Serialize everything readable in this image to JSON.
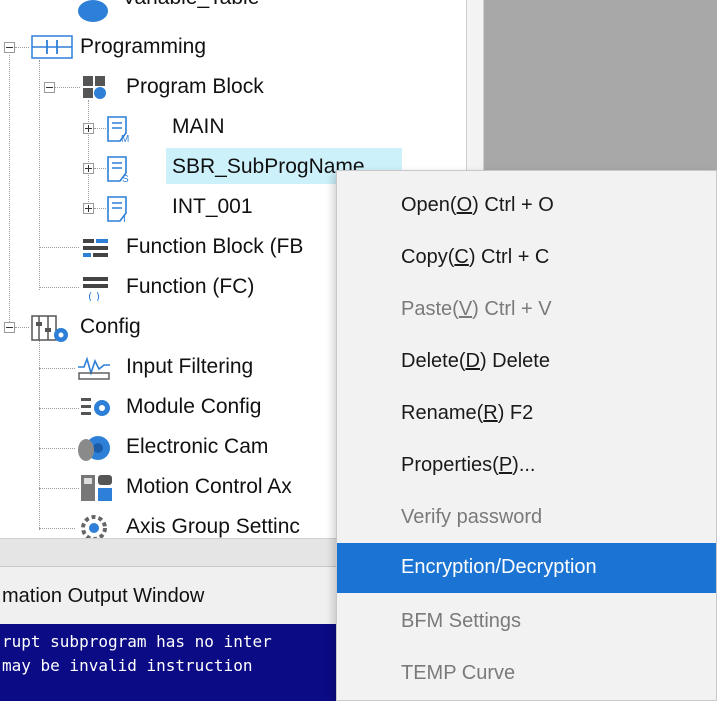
{
  "tree": {
    "items": [
      {
        "label": "Variable_Table",
        "icon": "variable-table-icon"
      },
      {
        "label": "Programming",
        "icon": "ladder-icon",
        "expander": "minus"
      },
      {
        "label": "Program Block",
        "icon": "program-block-icon",
        "expander": "minus"
      },
      {
        "label": "MAIN",
        "icon": "main-program-icon",
        "expander": "plus"
      },
      {
        "label": "SBR_SubProgName",
        "icon": "subroutine-icon",
        "expander": "plus",
        "selected": true
      },
      {
        "label": "INT_001",
        "icon": "interrupt-icon",
        "expander": "plus"
      },
      {
        "label": "Function Block (FB",
        "icon": "function-block-icon"
      },
      {
        "label": "Function (FC)",
        "icon": "function-icon"
      },
      {
        "label": "Config",
        "icon": "config-icon",
        "expander": "minus"
      },
      {
        "label": "Input Filtering",
        "icon": "input-filtering-icon"
      },
      {
        "label": "Module Config",
        "icon": "module-config-icon"
      },
      {
        "label": "Electronic Cam",
        "icon": "electronic-cam-icon"
      },
      {
        "label": "Motion Control Ax",
        "icon": "motion-control-icon"
      },
      {
        "label": "Axis Group Settinc",
        "icon": "axis-group-icon"
      }
    ]
  },
  "output": {
    "title": "mation Output Window",
    "lines": [
      "rupt subprogram has no inter",
      " may be invalid instruction"
    ]
  },
  "menu": {
    "items": [
      {
        "label": "Open(O) Ctrl + O",
        "pre": "Open(",
        "key": "O",
        "post": ") Ctrl + O",
        "enabled": true
      },
      {
        "label": "Copy(C) Ctrl + C",
        "pre": "Copy(",
        "key": "C",
        "post": ") Ctrl + C",
        "enabled": true
      },
      {
        "label": "Paste(V) Ctrl + V",
        "pre": "Paste(",
        "key": "V",
        "post": ") Ctrl + V",
        "enabled": false
      },
      {
        "label": "Delete(D) Delete",
        "pre": "Delete(",
        "key": "D",
        "post": ") Delete",
        "enabled": true
      },
      {
        "label": "Rename(R) F2",
        "pre": "Rename(",
        "key": "R",
        "post": ") F2",
        "enabled": true
      },
      {
        "label": "Properties(P)...",
        "pre": "Properties(",
        "key": "P",
        "post": ")...",
        "enabled": true
      },
      {
        "label": "Verify password",
        "pre": "Verify password",
        "key": "",
        "post": "",
        "enabled": false
      },
      {
        "label": "Encryption/Decryption",
        "pre": "Encryption/Decryption",
        "key": "",
        "post": "",
        "enabled": true,
        "highlighted": true
      },
      {
        "label": "BFM Settings",
        "pre": "BFM Settings",
        "key": "",
        "post": "",
        "enabled": false
      },
      {
        "label": "TEMP Curve",
        "pre": "TEMP Curve",
        "key": "",
        "post": "",
        "enabled": false
      }
    ]
  },
  "colors": {
    "selection_bg": "#cdf1fb",
    "menu_highlight": "#1b74d3",
    "console_bg": "#0b0b86",
    "icon_blue": "#2d7fd8"
  }
}
